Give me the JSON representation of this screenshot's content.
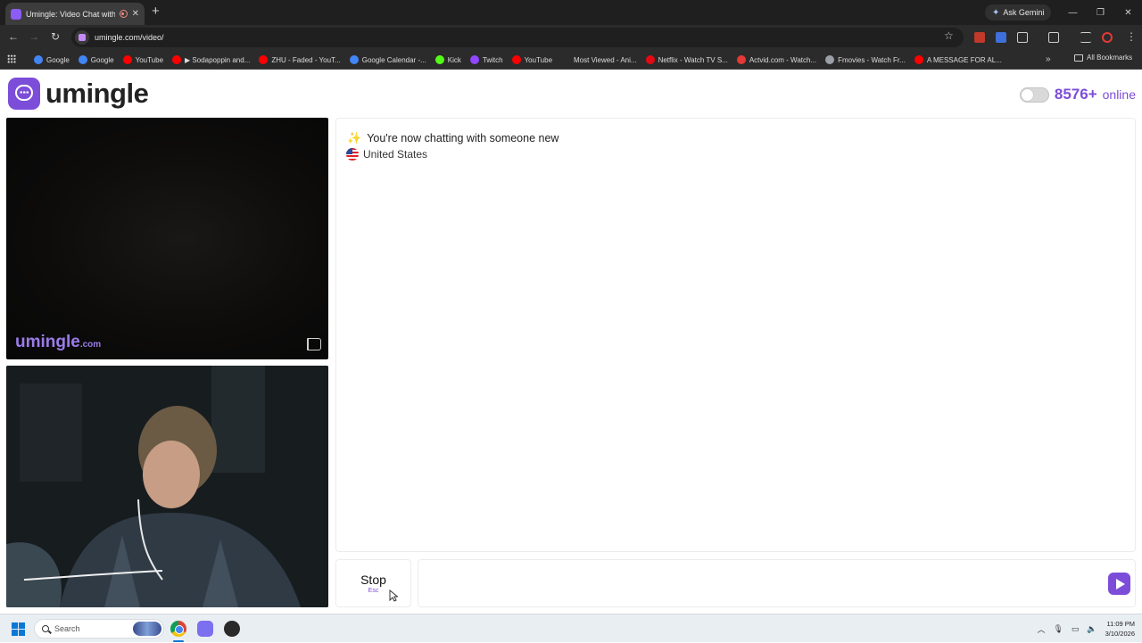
{
  "browser": {
    "tab_title": "Umingle: Video Chat with S",
    "tab_close": "✕",
    "new_tab": "+",
    "ask_gemini": "Ask Gemini",
    "url": "umingle.com/video/",
    "window_controls": [
      "—",
      "❐",
      "✕"
    ],
    "bookmarks": [
      {
        "label": "Google",
        "icon_color": "#4285f4"
      },
      {
        "label": "Google",
        "icon_color": "#4285f4"
      },
      {
        "label": "YouTube",
        "icon_color": "#ff0000"
      },
      {
        "label": "▶ Sodapoppin and...",
        "icon_color": "#ff0000"
      },
      {
        "label": "ZHU - Faded - YouT...",
        "icon_color": "#ff0000"
      },
      {
        "label": "Google Calendar -...",
        "icon_color": "#4285f4"
      },
      {
        "label": "Kick",
        "icon_color": "#53fc18"
      },
      {
        "label": "Twitch",
        "icon_color": "#9146ff"
      },
      {
        "label": "YouTube",
        "icon_color": "#ff0000"
      },
      {
        "label": "Most Viewed - Ani...",
        "icon_color": "#2b2b2b"
      },
      {
        "label": "Netflix - Watch TV S...",
        "icon_color": "#e50914"
      },
      {
        "label": "Actvid.com - Watch...",
        "icon_color": "#e53935"
      },
      {
        "label": "Fmovies - Watch Fr...",
        "icon_color": "#9aa0a6"
      },
      {
        "label": "A MESSAGE FOR AL...",
        "icon_color": "#ff0000"
      }
    ],
    "bookmarks_more": "»",
    "all_bookmarks": "All Bookmarks"
  },
  "header": {
    "logo_text": "umingle",
    "online_count": "8576+",
    "online_label": "online"
  },
  "remote_video": {
    "watermark_main": "umingle",
    "watermark_domain": ".com"
  },
  "chat": {
    "status_message": "You're now chatting with someone new",
    "country": "United States"
  },
  "controls": {
    "stop_label": "Stop",
    "stop_hint": "Esc",
    "message_placeholder": ""
  },
  "taskbar": {
    "search_placeholder": "Search",
    "time": "11:09 PM",
    "date": "3/10/2026"
  },
  "colors": {
    "brand": "#7c4dd8",
    "chrome_dark": "#2b2b2b"
  }
}
